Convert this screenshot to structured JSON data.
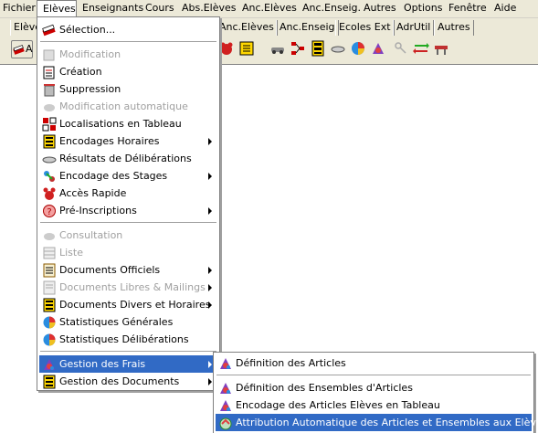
{
  "menubar": {
    "items": [
      "Fichier",
      "Elèves",
      "Enseignants",
      "Cours",
      "Abs.Elèves",
      "Anc.Elèves",
      "Anc.Enseig.",
      "Autres",
      "Options",
      "Fenêtre",
      "Aide"
    ]
  },
  "tabs": [
    "Elève",
    "Anc.Elèves",
    "Anc.Enseig",
    "Ecoles Ext",
    "AdrUtil",
    "Autres"
  ],
  "toolbar_first_label": "A",
  "eleves_menu": {
    "items": [
      {
        "label": "Sélection...",
        "enabled": true,
        "submenu": false,
        "icon": "selection-icon"
      },
      {
        "label": "Modification",
        "enabled": false,
        "submenu": false,
        "icon": "modification-icon"
      },
      {
        "label": "Création",
        "enabled": true,
        "submenu": false,
        "icon": "creation-icon"
      },
      {
        "label": "Suppression",
        "enabled": true,
        "submenu": false,
        "icon": "trash-icon"
      },
      {
        "label": "Modification automatique",
        "enabled": false,
        "submenu": false,
        "icon": "auto-modification-icon"
      },
      {
        "label": "Localisations en Tableau",
        "enabled": true,
        "submenu": false,
        "icon": "table-icon"
      },
      {
        "label": "Encodages Horaires",
        "enabled": true,
        "submenu": true,
        "icon": "schedule-icon"
      },
      {
        "label": "Résultats de Délibérations",
        "enabled": true,
        "submenu": false,
        "icon": "results-icon"
      },
      {
        "label": "Encodage des Stages",
        "enabled": true,
        "submenu": true,
        "icon": "stages-icon"
      },
      {
        "label": "Accès Rapide",
        "enabled": true,
        "submenu": false,
        "icon": "quick-access-icon"
      },
      {
        "label": "Pré-Inscriptions",
        "enabled": true,
        "submenu": true,
        "icon": "pre-registration-icon"
      },
      {
        "label": "Consultation",
        "enabled": false,
        "submenu": false,
        "icon": "consultation-icon"
      },
      {
        "label": "Liste",
        "enabled": false,
        "submenu": false,
        "icon": "list-icon"
      },
      {
        "label": "Documents Officiels",
        "enabled": true,
        "submenu": true,
        "icon": "official-docs-icon"
      },
      {
        "label": "Documents Libres  & Mailings",
        "enabled": false,
        "submenu": true,
        "icon": "free-docs-icon"
      },
      {
        "label": "Documents Divers et Horaires",
        "enabled": true,
        "submenu": true,
        "icon": "misc-docs-icon"
      },
      {
        "label": "Statistiques Générales",
        "enabled": true,
        "submenu": false,
        "icon": "stats-icon"
      },
      {
        "label": "Statistiques Délibérations",
        "enabled": true,
        "submenu": false,
        "icon": "stats-deliberations-icon"
      },
      {
        "label": "Gestion des Frais",
        "enabled": true,
        "submenu": true,
        "icon": "fees-icon",
        "highlighted": true
      },
      {
        "label": "Gestion des Documents",
        "enabled": true,
        "submenu": true,
        "icon": "documents-icon"
      }
    ]
  },
  "frais_submenu": {
    "items": [
      {
        "label": "Définition des Articles",
        "icon": "articles-icon"
      },
      {
        "label": "Définition des Ensembles d'Articles",
        "icon": "article-sets-icon"
      },
      {
        "label": "Encodage des Articles Elèves en Tableau",
        "icon": "articles-table-icon"
      },
      {
        "label": "Attribution Automatique des Articles et Ensembles aux Elèves",
        "icon": "auto-attribution-icon",
        "highlighted": true
      }
    ]
  },
  "colors": {
    "highlight": "#316ac5",
    "chrome": "#ece9d8",
    "disabled": "#a0a0a0"
  }
}
